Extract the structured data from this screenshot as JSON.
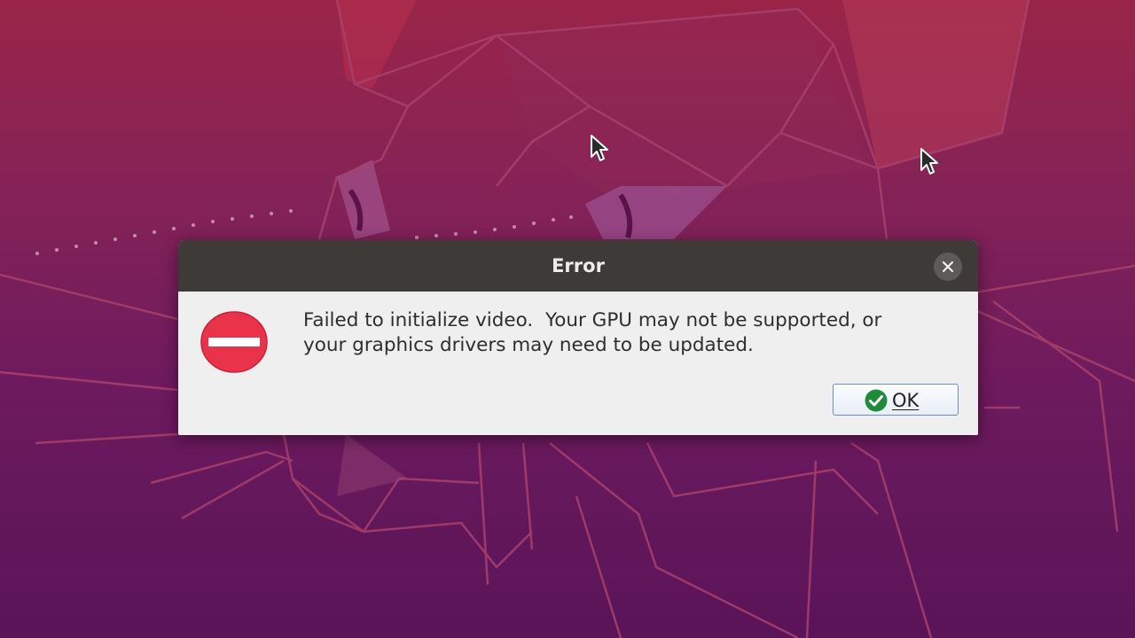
{
  "dialog": {
    "title": "Error",
    "message_line1": "Failed to initialize video.  Your GPU may not be supported, or",
    "message_line2": "your graphics drivers may need to be updated.",
    "ok_label": "OK",
    "icon": "error-stop-icon",
    "close_icon": "close-icon"
  },
  "colors": {
    "titlebar": "#3d3a37",
    "dialog_body": "#efefef",
    "error_red": "#e8334a",
    "ok_check_green": "#1f8a3a",
    "wallpaper_top": "#9a2448",
    "wallpaper_bottom": "#5a1458"
  },
  "desktop": {
    "wallpaper": "ubuntu-focal-fossa-wallpaper",
    "cursors": [
      "mouse-pointer-icon",
      "mouse-pointer-icon"
    ]
  }
}
